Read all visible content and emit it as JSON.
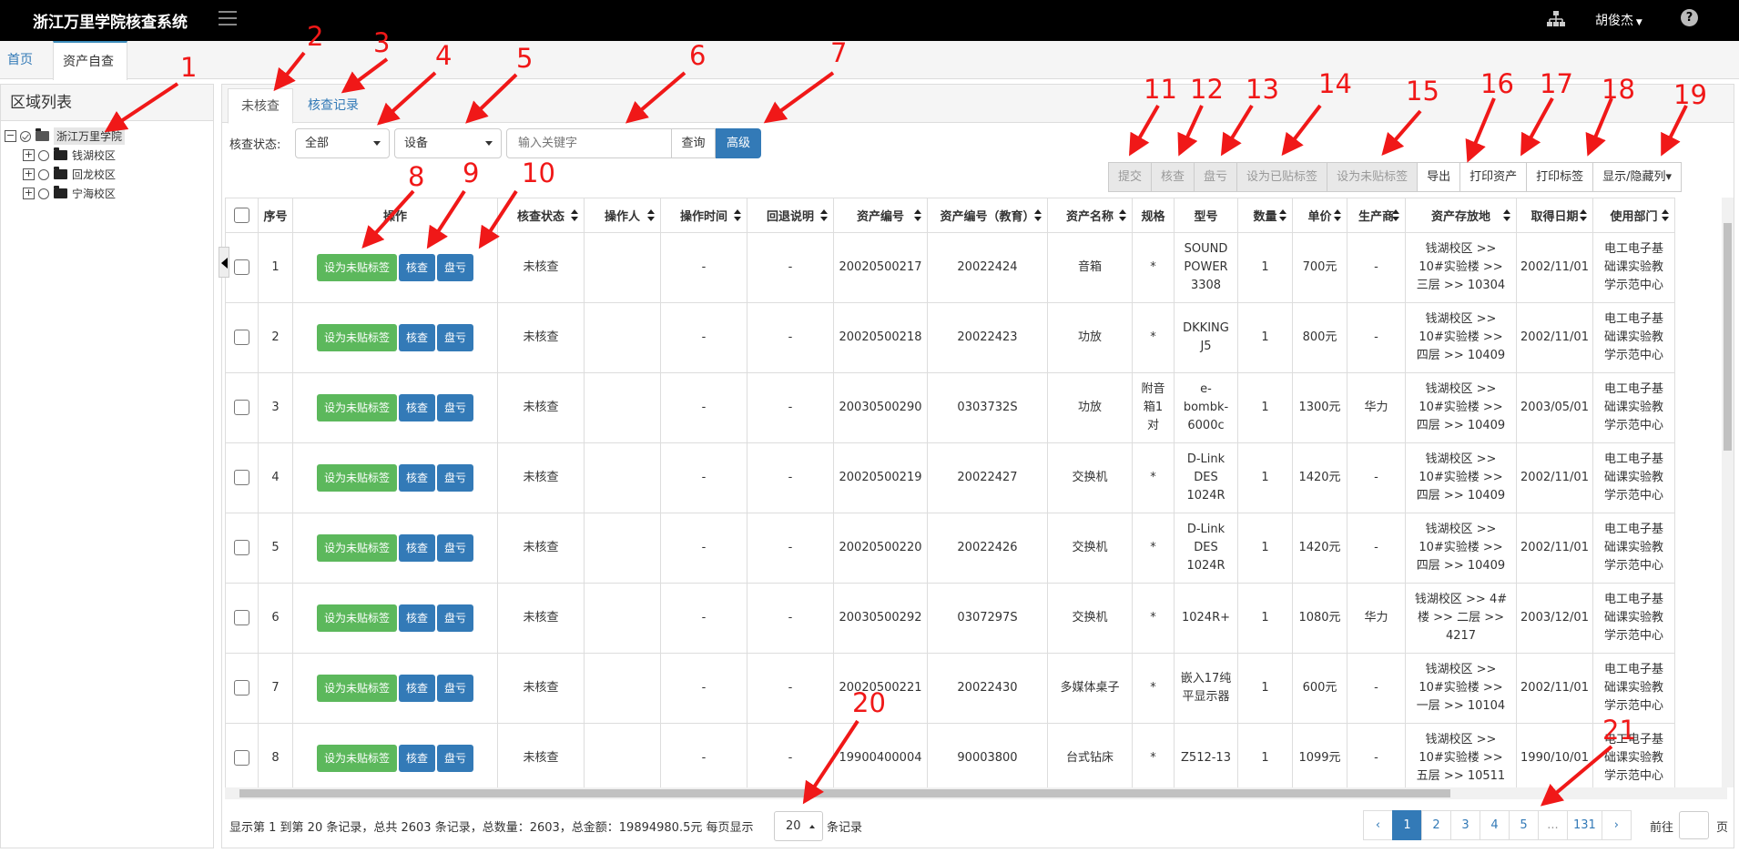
{
  "app": {
    "title": "浙江万里学院核查系统",
    "user": "胡俊杰",
    "help_glyph": "?"
  },
  "icons": {
    "menu": "hamburger-icon",
    "sitemap": "sitemap-icon",
    "help": "help-icon"
  },
  "main_tabs": [
    "首页",
    "资产自查"
  ],
  "sidebar": {
    "title": "区域列表",
    "tree": [
      {
        "label": "浙江万里学院",
        "expander": "−",
        "level": 0,
        "selected": true
      },
      {
        "label": "钱湖校区",
        "expander": "+",
        "level": 1
      },
      {
        "label": "回龙校区",
        "expander": "+",
        "level": 1
      },
      {
        "label": "宁海校区",
        "expander": "+",
        "level": 1
      }
    ]
  },
  "sub_tabs": [
    "未核查",
    "核查记录"
  ],
  "filters": {
    "status_label": "核查状态:",
    "status_value": "全部",
    "type_value": "设备",
    "search_placeholder": "输入关键字",
    "query_label": "查询",
    "advanced_label": "高级"
  },
  "toolbar": [
    {
      "label": "提交",
      "enabled": false
    },
    {
      "label": "核查",
      "enabled": false
    },
    {
      "label": "盘亏",
      "enabled": false
    },
    {
      "label": "设为已贴标签",
      "enabled": false
    },
    {
      "label": "设为未贴标签",
      "enabled": false
    },
    {
      "label": "导出",
      "enabled": true
    },
    {
      "label": "打印资产",
      "enabled": true
    },
    {
      "label": "打印标签",
      "enabled": true
    },
    {
      "label": "显示/隐藏列▾",
      "enabled": true
    }
  ],
  "table": {
    "headers": [
      "序号",
      "操作",
      "核查状态",
      "操作人",
      "操作时间",
      "回退说明",
      "资产编号",
      "资产编号（教育）",
      "资产名称",
      "规格",
      "型号",
      "数量",
      "单价",
      "生产商",
      "资产存放地",
      "取得日期",
      "使用部门"
    ],
    "action_labels": {
      "tag": "设为未贴标签",
      "check": "核查",
      "loss": "盘亏"
    },
    "rows": [
      {
        "no": "1",
        "status": "未核查",
        "operator": "",
        "op_time": "-",
        "rollback": "-",
        "asset_no": "20020500217",
        "asset_no_edu": "20022424",
        "name": "音箱",
        "spec": "*",
        "model": "SOUND POWER 3308",
        "qty": "1",
        "price": "700元",
        "maker": "-",
        "location": "钱湖校区 >> 10#实验楼 >> 三层 >> 10304",
        "date": "2002/11/01",
        "dept": "电工电子基础课实验教学示范中心"
      },
      {
        "no": "2",
        "status": "未核查",
        "operator": "",
        "op_time": "-",
        "rollback": "-",
        "asset_no": "20020500218",
        "asset_no_edu": "20022423",
        "name": "功放",
        "spec": "*",
        "model": "DKKING J5",
        "qty": "1",
        "price": "800元",
        "maker": "-",
        "location": "钱湖校区 >> 10#实验楼 >> 四层 >> 10409",
        "date": "2002/11/01",
        "dept": "电工电子基础课实验教学示范中心"
      },
      {
        "no": "3",
        "status": "未核查",
        "operator": "",
        "op_time": "-",
        "rollback": "-",
        "asset_no": "20030500290",
        "asset_no_edu": "0303732S",
        "name": "功放",
        "spec": "附音箱1对",
        "model": "e-bombk-6000c",
        "qty": "1",
        "price": "1300元",
        "maker": "华力",
        "location": "钱湖校区 >> 10#实验楼 >> 四层 >> 10409",
        "date": "2003/05/01",
        "dept": "电工电子基础课实验教学示范中心"
      },
      {
        "no": "4",
        "status": "未核查",
        "operator": "",
        "op_time": "-",
        "rollback": "-",
        "asset_no": "20020500219",
        "asset_no_edu": "20022427",
        "name": "交换机",
        "spec": "*",
        "model": "D-Link DES 1024R",
        "qty": "1",
        "price": "1420元",
        "maker": "-",
        "location": "钱湖校区 >> 10#实验楼 >> 四层 >> 10409",
        "date": "2002/11/01",
        "dept": "电工电子基础课实验教学示范中心"
      },
      {
        "no": "5",
        "status": "未核查",
        "operator": "",
        "op_time": "-",
        "rollback": "-",
        "asset_no": "20020500220",
        "asset_no_edu": "20022426",
        "name": "交换机",
        "spec": "*",
        "model": "D-Link DES 1024R",
        "qty": "1",
        "price": "1420元",
        "maker": "-",
        "location": "钱湖校区 >> 10#实验楼 >> 四层 >> 10409",
        "date": "2002/11/01",
        "dept": "电工电子基础课实验教学示范中心"
      },
      {
        "no": "6",
        "status": "未核查",
        "operator": "",
        "op_time": "-",
        "rollback": "-",
        "asset_no": "20030500292",
        "asset_no_edu": "0307297S",
        "name": "交换机",
        "spec": "*",
        "model": "1024R+",
        "qty": "1",
        "price": "1080元",
        "maker": "华力",
        "location": "钱湖校区 >> 4#楼 >> 二层 >> 4217",
        "date": "2003/12/01",
        "dept": "电工电子基础课实验教学示范中心"
      },
      {
        "no": "7",
        "status": "未核查",
        "operator": "",
        "op_time": "-",
        "rollback": "-",
        "asset_no": "20020500221",
        "asset_no_edu": "20022430",
        "name": "多媒体桌子",
        "spec": "*",
        "model": "嵌入17纯平显示器",
        "qty": "1",
        "price": "600元",
        "maker": "-",
        "location": "钱湖校区 >> 10#实验楼 >> 一层 >> 10104",
        "date": "2002/11/01",
        "dept": "电工电子基础课实验教学示范中心"
      },
      {
        "no": "8",
        "status": "未核查",
        "operator": "",
        "op_time": "-",
        "rollback": "-",
        "asset_no": "19900400004",
        "asset_no_edu": "90003800",
        "name": "台式钻床",
        "spec": "*",
        "model": "Z512-13",
        "qty": "1",
        "price": "1099元",
        "maker": "-",
        "location": "钱湖校区 >> 10#实验楼 >> 五层 >> 10511",
        "date": "1990/10/01",
        "dept": "电工电子基础课实验教学示范中心"
      }
    ]
  },
  "footer": {
    "info": "显示第 1 到第 20 条记录，总共 2603 条记录，总数量：2603，总金额：19894980.5元 每页显示",
    "page_size": "20",
    "records_suffix": "条记录",
    "pages": [
      "‹",
      "1",
      "2",
      "3",
      "4",
      "5",
      "...",
      "131",
      "›"
    ],
    "active_page": "1",
    "goto_label": "前往",
    "goto_suffix": "页"
  },
  "annotations": [
    "1",
    "2",
    "3",
    "4",
    "5",
    "6",
    "7",
    "8",
    "9",
    "10",
    "11",
    "12",
    "13",
    "14",
    "15",
    "16",
    "17",
    "18",
    "19",
    "20",
    "21"
  ],
  "colors": {
    "annotation": "#f01818",
    "primary": "#337ab7",
    "success": "#5cb85c",
    "topbar": "#000000"
  }
}
